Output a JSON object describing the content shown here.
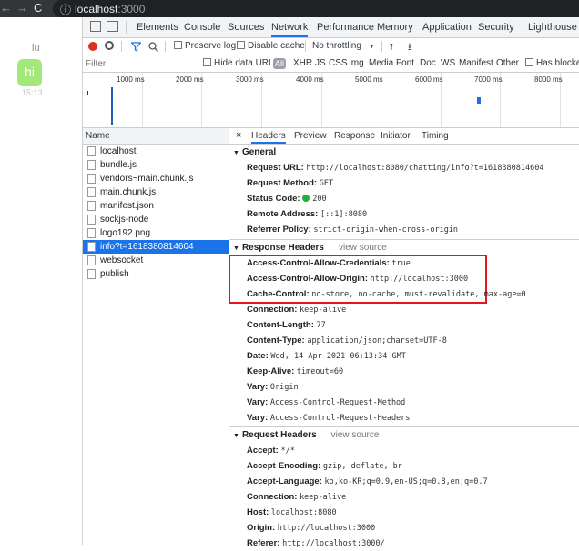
{
  "browser": {
    "url_host": "localhost",
    "url_port": ":3000"
  },
  "page": {
    "user_name": "iu",
    "message": "hi",
    "time": "15:13"
  },
  "devtools": {
    "tabs": [
      "Elements",
      "Console",
      "Sources",
      "Network",
      "Performance",
      "Memory",
      "Application",
      "Security",
      "Lighthouse"
    ],
    "active_tab": "Network",
    "toolbar": {
      "preserve_log": "Preserve log",
      "disable_cache": "Disable cache",
      "throttling": "No throttling"
    },
    "filter": {
      "placeholder": "Filter",
      "hide_data_urls": "Hide data URLs",
      "all": "All",
      "types": [
        "XHR",
        "JS",
        "CSS",
        "Img",
        "Media",
        "Font",
        "Doc",
        "WS",
        "Manifest",
        "Other"
      ],
      "has_blocked": "Has blocke"
    },
    "timeline_ticks": [
      "1000 ms",
      "2000 ms",
      "3000 ms",
      "4000 ms",
      "5000 ms",
      "6000 ms",
      "7000 ms",
      "8000 ms"
    ],
    "list_header": "Name",
    "requests": [
      "localhost",
      "bundle.js",
      "vendors~main.chunk.js",
      "main.chunk.js",
      "manifest.json",
      "sockjs-node",
      "logo192.png",
      "info?t=1618380814604",
      "websocket",
      "publish"
    ],
    "selected_request": "info?t=1618380814604",
    "detail_tabs": [
      "Headers",
      "Preview",
      "Response",
      "Initiator",
      "Timing"
    ],
    "active_detail_tab": "Headers",
    "general": {
      "title": "General",
      "rows": [
        {
          "k": "Request URL:",
          "v": "http://localhost:8080/chatting/info?t=1618380814604"
        },
        {
          "k": "Request Method:",
          "v": "GET"
        },
        {
          "k": "Status Code:",
          "v": "200"
        },
        {
          "k": "Remote Address:",
          "v": "[::1]:8080"
        },
        {
          "k": "Referrer Policy:",
          "v": "strict-origin-when-cross-origin"
        }
      ]
    },
    "response_headers": {
      "title": "Response Headers",
      "view_source": "view source",
      "rows": [
        {
          "k": "Access-Control-Allow-Credentials:",
          "v": "true"
        },
        {
          "k": "Access-Control-Allow-Origin:",
          "v": "http://localhost:3000"
        },
        {
          "k": "Cache-Control:",
          "v": "no-store, no-cache, must-revalidate, max-age=0"
        },
        {
          "k": "Connection:",
          "v": "keep-alive"
        },
        {
          "k": "Content-Length:",
          "v": "77"
        },
        {
          "k": "Content-Type:",
          "v": "application/json;charset=UTF-8"
        },
        {
          "k": "Date:",
          "v": "Wed, 14 Apr 2021 06:13:34 GMT"
        },
        {
          "k": "Keep-Alive:",
          "v": "timeout=60"
        },
        {
          "k": "Vary:",
          "v": "Origin"
        },
        {
          "k": "Vary:",
          "v": "Access-Control-Request-Method"
        },
        {
          "k": "Vary:",
          "v": "Access-Control-Request-Headers"
        }
      ]
    },
    "request_headers": {
      "title": "Request Headers",
      "view_source": "view source",
      "rows": [
        {
          "k": "Accept:",
          "v": "*/*"
        },
        {
          "k": "Accept-Encoding:",
          "v": "gzip, deflate, br"
        },
        {
          "k": "Accept-Language:",
          "v": "ko,ko-KR;q=0.9,en-US;q=0.8,en;q=0.7"
        },
        {
          "k": "Connection:",
          "v": "keep-alive"
        },
        {
          "k": "Host:",
          "v": "localhost:8080"
        },
        {
          "k": "Origin:",
          "v": "http://localhost:3000"
        },
        {
          "k": "Referer:",
          "v": "http://localhost:3000/"
        }
      ]
    },
    "colors": {
      "accent": "#1a73e8",
      "highlight": "#e4151c",
      "status_ok": "#1db03b",
      "record": "#d93025"
    }
  }
}
